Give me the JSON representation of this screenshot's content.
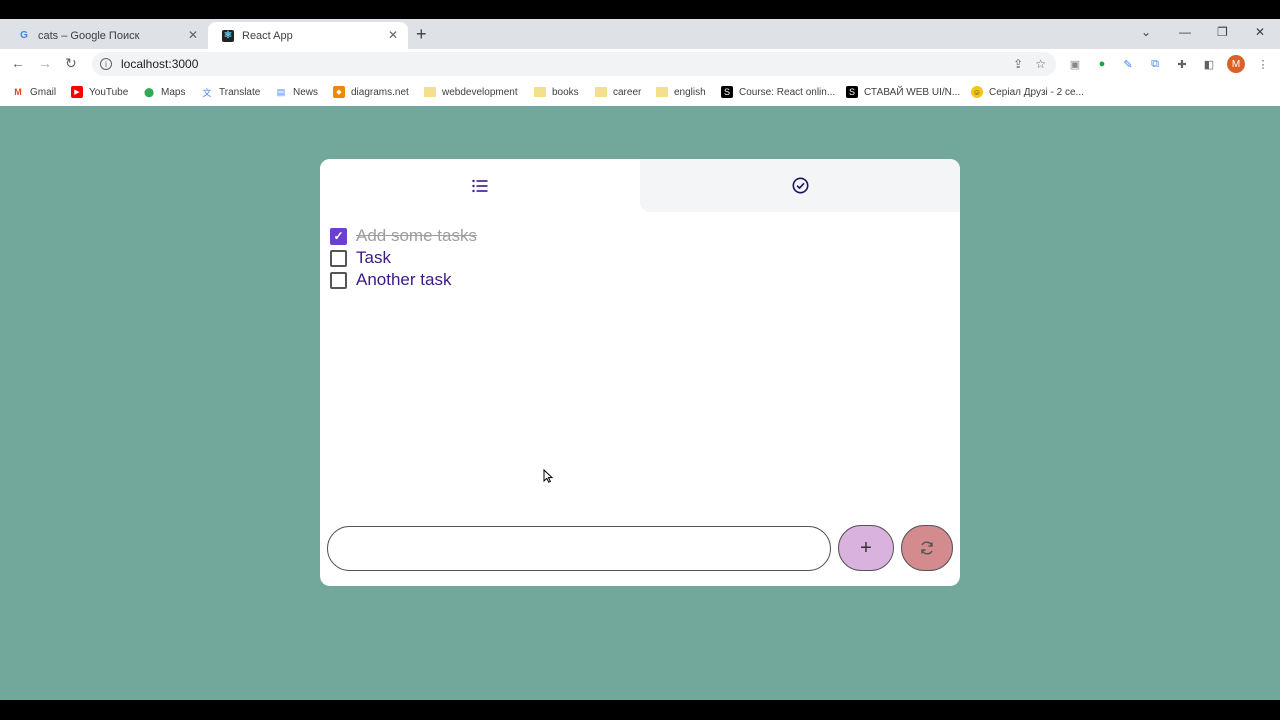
{
  "browser": {
    "tabs": [
      {
        "title": "cats – Google Поиск",
        "favicon": "G",
        "active": false
      },
      {
        "title": "React App",
        "favicon": "react-icon",
        "active": true
      }
    ],
    "url": "localhost:3000",
    "avatar_letter": "M",
    "bookmarks": [
      {
        "label": "Gmail",
        "icon": "gmail-icon"
      },
      {
        "label": "YouTube",
        "icon": "youtube-icon"
      },
      {
        "label": "Maps",
        "icon": "maps-icon"
      },
      {
        "label": "Translate",
        "icon": "translate-icon"
      },
      {
        "label": "News",
        "icon": "news-icon"
      },
      {
        "label": "diagrams.net",
        "icon": "diagrams-icon"
      },
      {
        "label": "webdevelopment",
        "icon": "folder-icon"
      },
      {
        "label": "books",
        "icon": "folder-icon"
      },
      {
        "label": "career",
        "icon": "folder-icon"
      },
      {
        "label": "english",
        "icon": "folder-icon"
      },
      {
        "label": "Course: React onlin...",
        "icon": "s-icon"
      },
      {
        "label": "СТАВАЙ WEB UI/N...",
        "icon": "s-icon"
      },
      {
        "label": "Серіал Друзі - 2 се...",
        "icon": "emoji-icon"
      }
    ]
  },
  "app": {
    "background": "#72a79c",
    "tabs": [
      {
        "name": "list",
        "icon": "list-icon",
        "active": true
      },
      {
        "name": "completed",
        "icon": "check-circle-icon",
        "active": false
      }
    ],
    "tasks": [
      {
        "label": "Add some tasks",
        "done": true
      },
      {
        "label": "Task",
        "done": false
      },
      {
        "label": "Another task",
        "done": false
      }
    ],
    "input": {
      "value": "",
      "placeholder": ""
    },
    "add_button_label": "+",
    "accent": "#6a3fd1",
    "text_color": "#3b1a86",
    "add_button_color": "#d9b2dd",
    "reset_button_color": "#d38b8e"
  }
}
